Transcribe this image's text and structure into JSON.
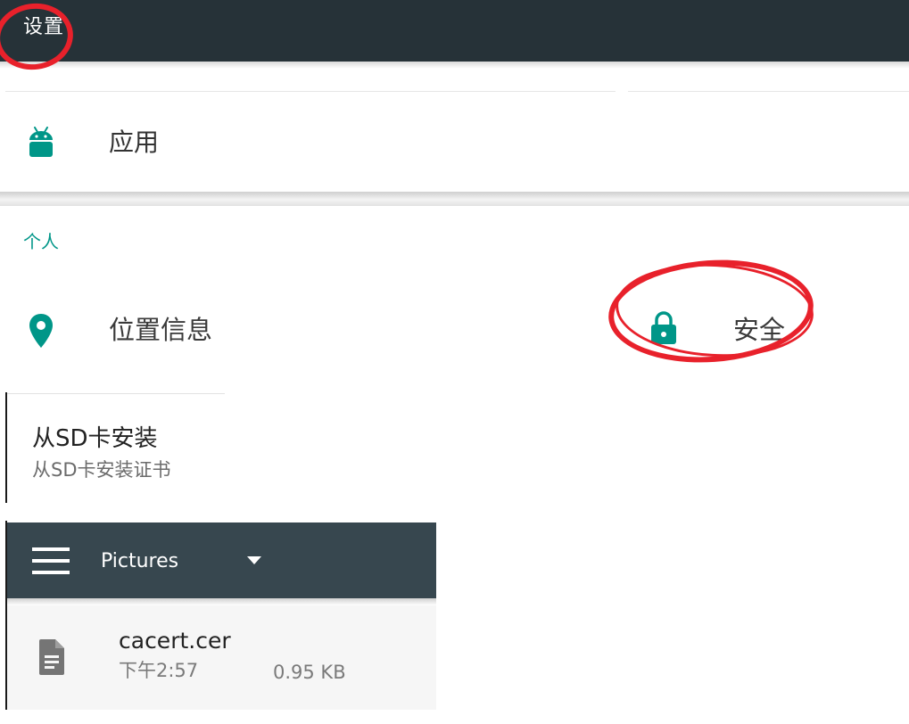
{
  "settings": {
    "title": "设置"
  },
  "apps": {
    "label": "应用",
    "icon": "android-icon",
    "icon_color": "#009688"
  },
  "personal": {
    "section_title": "个人",
    "section_color": "#009688",
    "location": {
      "label": "位置信息",
      "icon": "location-pin-icon"
    },
    "security": {
      "label": "安全",
      "icon": "lock-icon"
    }
  },
  "install_from_sd": {
    "title": "从SD卡安装",
    "subtitle": "从SD卡安装证书"
  },
  "file_picker": {
    "menu_icon": "hamburger-menu-icon",
    "folder": "Pictures",
    "dropdown_icon": "dropdown-arrow-icon",
    "header_color": "#37474f",
    "files": [
      {
        "name": "cacert.cer",
        "time": "下午2:57",
        "size": "0.95 KB",
        "icon": "document-icon"
      }
    ]
  },
  "annotations": {
    "color": "#e8212b",
    "circled": [
      "settings-title",
      "security-item"
    ]
  }
}
